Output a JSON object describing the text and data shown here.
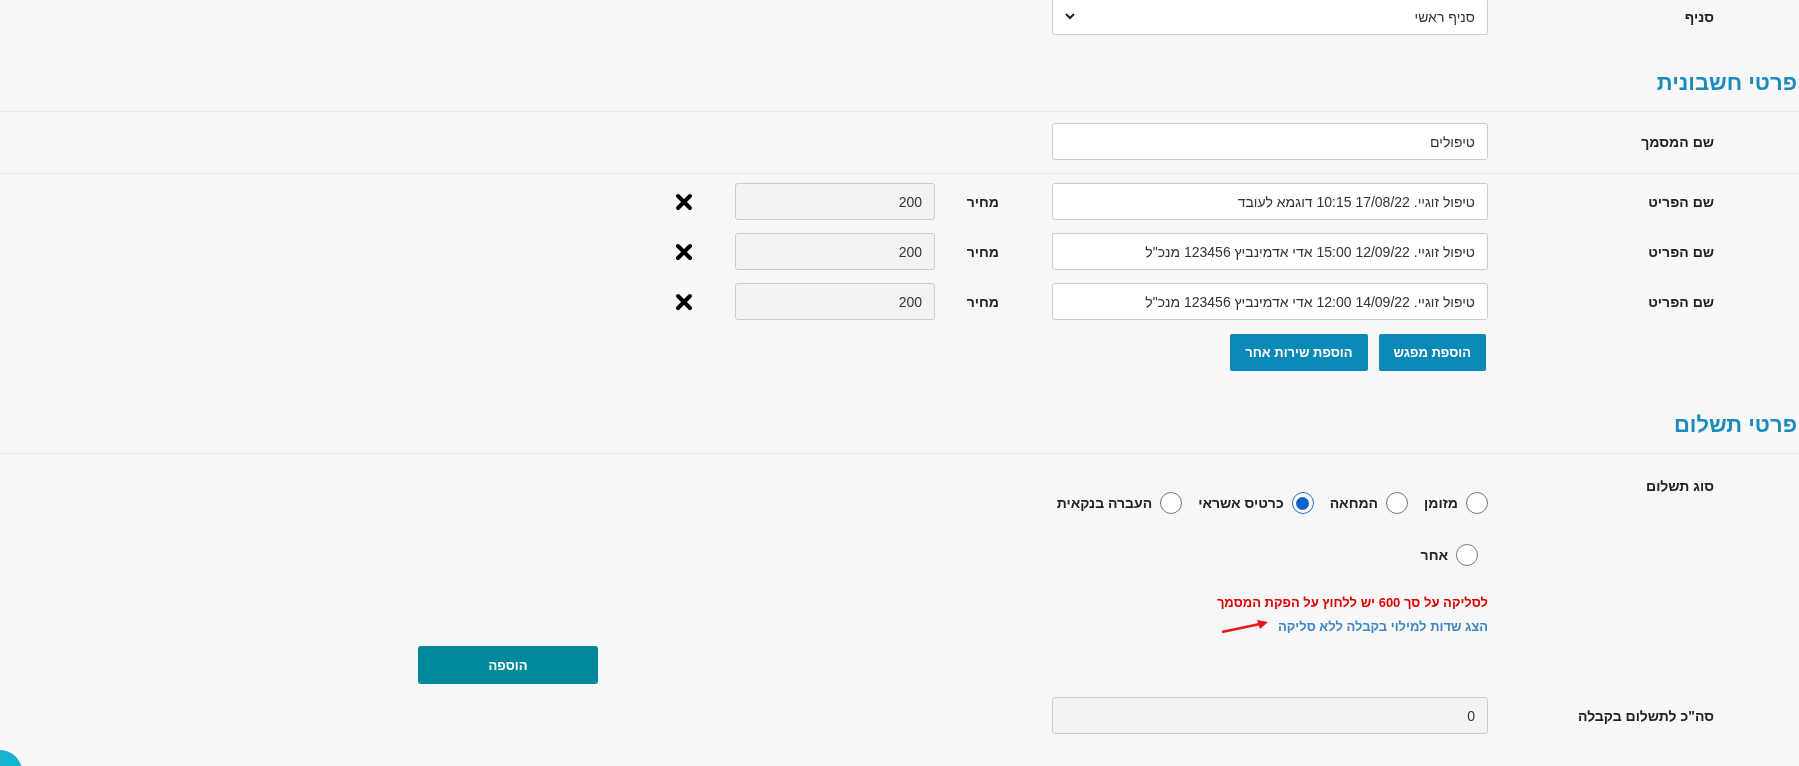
{
  "branch": {
    "label": "סניף",
    "value": "סניף ראשי"
  },
  "invoice_section": {
    "title": "פרטי חשבונית",
    "document_name": {
      "label": "שם המסמך",
      "value": "טיפולים"
    },
    "items": [
      {
        "label": "שם הפריט",
        "name": "טיפול זוגיי. 17/08/22 10:15 דוגמא לעובד",
        "price_label": "מחיר",
        "price": "200"
      },
      {
        "label": "שם הפריט",
        "name": "טיפול זוגיי. 12/09/22 15:00 אדי אדמינביץ 123456 מנכ\"ל",
        "price_label": "מחיר",
        "price": "200"
      },
      {
        "label": "שם הפריט",
        "name": "טיפול זוגיי. 14/09/22 12:00 אדי אדמינביץ 123456 מנכ\"ל",
        "price_label": "מחיר",
        "price": "200"
      }
    ],
    "buttons": [
      "הוספת מפגש",
      "הוספת שירות אחר"
    ]
  },
  "payment_section": {
    "title": "פרטי תשלום",
    "payment_type": {
      "label": "סוג תשלום",
      "options": [
        {
          "label": "מזומן",
          "selected": false
        },
        {
          "label": "המחאה",
          "selected": false
        },
        {
          "label": "כרטיס אשראי",
          "selected": true
        },
        {
          "label": "העברה בנקאית",
          "selected": false
        },
        {
          "label": "אחר",
          "selected": false
        }
      ]
    },
    "warning": "לסליקה על סך 600 יש ללחוץ על הפקת המסמך",
    "link": "הצג שדות למילוי בקבלה ללא סליקה",
    "add_button": "הוספה",
    "total": {
      "label": "סה\"כ לתשלום בקבלה",
      "value": "0"
    }
  }
}
